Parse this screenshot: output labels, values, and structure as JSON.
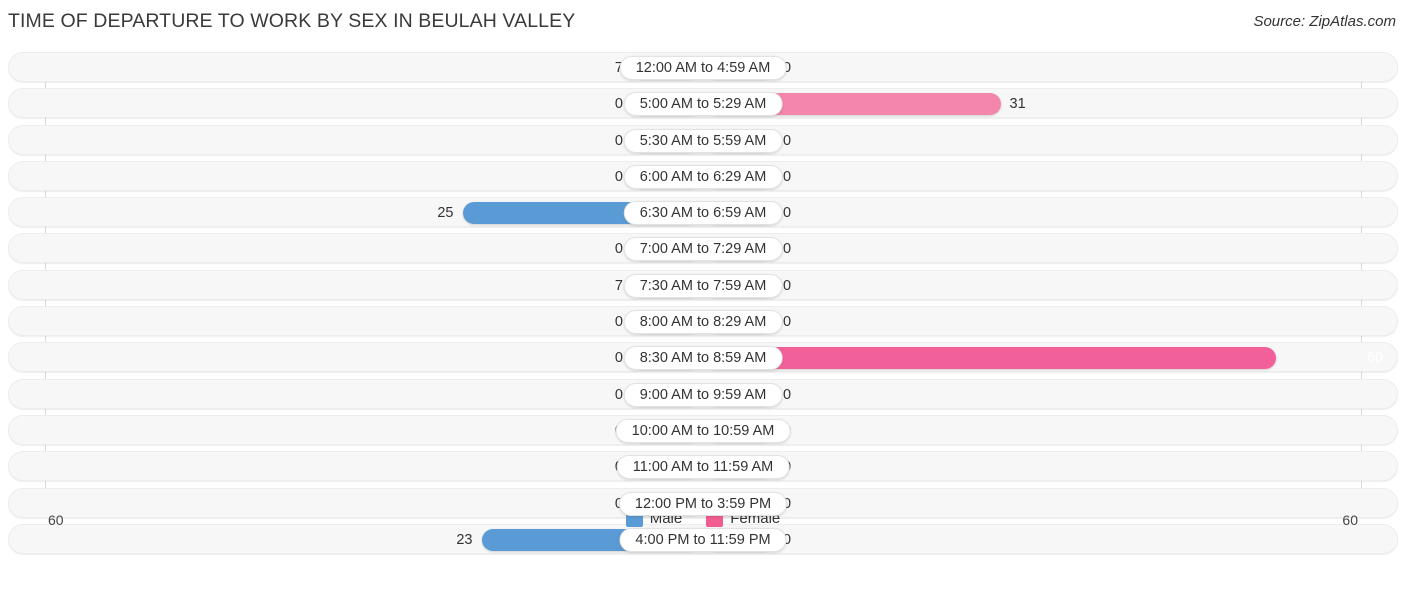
{
  "header": {
    "title": "TIME OF DEPARTURE TO WORK BY SEX IN BEULAH VALLEY",
    "source": "Source: ZipAtlas.com"
  },
  "legend": {
    "male_label": "Male",
    "female_label": "Female",
    "male_color": "#5b9bd5",
    "female_color": "#ef5d91"
  },
  "axis": {
    "left_max": "60",
    "right_max": "60"
  },
  "colors": {
    "male_light": "#a8cbec",
    "male_dark": "#5b9bd5",
    "female_light": "#fbb4cd",
    "female_mid": "#f485ad",
    "female_dark": "#f2609a",
    "track": "#f7f7f7",
    "gridline": "#d9d9d9",
    "text": "#333333"
  },
  "chart_data": {
    "type": "bar",
    "orientation": "horizontal",
    "style": "diverging-bidirectional",
    "title": "TIME OF DEPARTURE TO WORK BY SEX IN BEULAH VALLEY",
    "xlabel": "",
    "ylabel": "",
    "xlim": [
      60,
      60
    ],
    "grid": true,
    "legend_position": "bottom-center",
    "categories": [
      "12:00 AM to 4:59 AM",
      "5:00 AM to 5:29 AM",
      "5:30 AM to 5:59 AM",
      "6:00 AM to 6:29 AM",
      "6:30 AM to 6:59 AM",
      "7:00 AM to 7:29 AM",
      "7:30 AM to 7:59 AM",
      "8:00 AM to 8:29 AM",
      "8:30 AM to 8:59 AM",
      "9:00 AM to 9:59 AM",
      "10:00 AM to 10:59 AM",
      "11:00 AM to 11:59 AM",
      "12:00 PM to 3:59 PM",
      "4:00 PM to 11:59 PM"
    ],
    "series": [
      {
        "name": "Male",
        "values": [
          7,
          0,
          0,
          0,
          25,
          0,
          7,
          0,
          0,
          0,
          0,
          0,
          0,
          23
        ]
      },
      {
        "name": "Female",
        "values": [
          0,
          31,
          0,
          0,
          0,
          0,
          0,
          0,
          60,
          0,
          0,
          0,
          0,
          0
        ]
      }
    ]
  },
  "rows": [
    {
      "label": "12:00 AM to 4:59 AM",
      "male": "7",
      "female": "0",
      "male_v": 7,
      "female_v": 0
    },
    {
      "label": "5:00 AM to 5:29 AM",
      "male": "0",
      "female": "31",
      "male_v": 0,
      "female_v": 31
    },
    {
      "label": "5:30 AM to 5:59 AM",
      "male": "0",
      "female": "0",
      "male_v": 0,
      "female_v": 0
    },
    {
      "label": "6:00 AM to 6:29 AM",
      "male": "0",
      "female": "0",
      "male_v": 0,
      "female_v": 0
    },
    {
      "label": "6:30 AM to 6:59 AM",
      "male": "25",
      "female": "0",
      "male_v": 25,
      "female_v": 0
    },
    {
      "label": "7:00 AM to 7:29 AM",
      "male": "0",
      "female": "0",
      "male_v": 0,
      "female_v": 0
    },
    {
      "label": "7:30 AM to 7:59 AM",
      "male": "7",
      "female": "0",
      "male_v": 7,
      "female_v": 0
    },
    {
      "label": "8:00 AM to 8:29 AM",
      "male": "0",
      "female": "0",
      "male_v": 0,
      "female_v": 0
    },
    {
      "label": "8:30 AM to 8:59 AM",
      "male": "0",
      "female": "60",
      "male_v": 0,
      "female_v": 60
    },
    {
      "label": "9:00 AM to 9:59 AM",
      "male": "0",
      "female": "0",
      "male_v": 0,
      "female_v": 0
    },
    {
      "label": "10:00 AM to 10:59 AM",
      "male": "0",
      "female": "0",
      "male_v": 0,
      "female_v": 0
    },
    {
      "label": "11:00 AM to 11:59 AM",
      "male": "0",
      "female": "0",
      "male_v": 0,
      "female_v": 0
    },
    {
      "label": "12:00 PM to 3:59 PM",
      "male": "0",
      "female": "0",
      "male_v": 0,
      "female_v": 0
    },
    {
      "label": "4:00 PM to 11:59 PM",
      "male": "23",
      "female": "0",
      "male_v": 23,
      "female_v": 0
    }
  ]
}
